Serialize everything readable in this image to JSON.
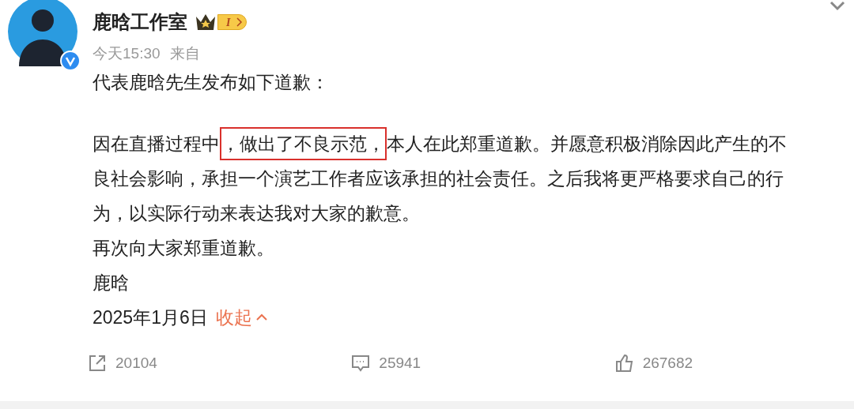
{
  "post": {
    "author": "鹿晗工作室",
    "level_badge": "I",
    "time": "今天15:30",
    "source_label": "来自",
    "intro": "代表鹿晗先生发布如下道歉：",
    "body_segments": [
      {
        "text": "因在直播过程中",
        "highlighted": false
      },
      {
        "text": "，做出了不良示范，",
        "highlighted": true
      },
      {
        "text": "本人在此郑重道歉。并愿意积极消除因此产生的不良社会影响，承担一个演艺工作者应该承担的社会责任。之后我将更严格要求自己的行为，以实际行动来表达我对大家的歉意。",
        "highlighted": false
      }
    ],
    "lines": [
      "再次向大家郑重道歉。",
      "鹿晗"
    ],
    "date": "2025年1月6日",
    "collapse_link": "收起"
  },
  "actions": [
    {
      "kind": "share",
      "count": "20104"
    },
    {
      "kind": "comment",
      "count": "25941"
    },
    {
      "kind": "like",
      "count": "267682"
    }
  ]
}
